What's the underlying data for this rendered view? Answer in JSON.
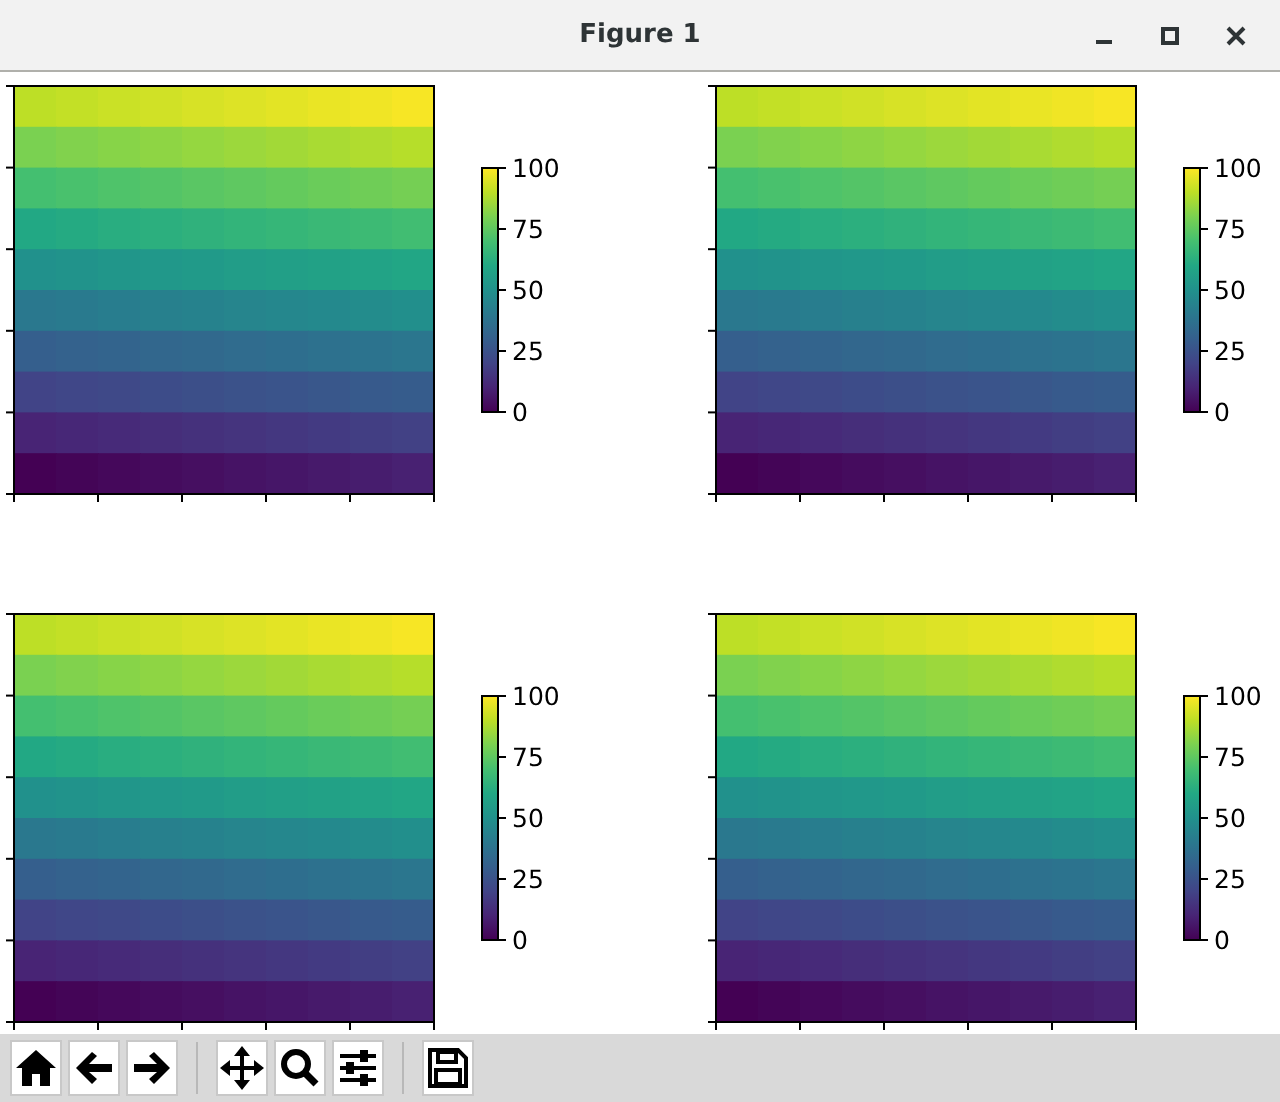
{
  "window": {
    "title": "Figure 1",
    "controls": [
      {
        "kind": "minimize"
      },
      {
        "kind": "maximize"
      },
      {
        "kind": "close"
      }
    ]
  },
  "subplots": [
    {
      "colorbar": {
        "ticks": [
          "100",
          "75",
          "50",
          "25",
          "0"
        ]
      }
    },
    {
      "colorbar": {
        "ticks": [
          "100",
          "75",
          "50",
          "25",
          "0"
        ]
      }
    },
    {
      "colorbar": {
        "ticks": [
          "100",
          "75",
          "50",
          "25",
          "0"
        ]
      }
    },
    {
      "colorbar": {
        "ticks": [
          "100",
          "75",
          "50",
          "25",
          "0"
        ]
      }
    }
  ],
  "toolbar": [
    {
      "kind": "home"
    },
    {
      "kind": "back"
    },
    {
      "kind": "forward"
    },
    {
      "kind": "separator"
    },
    {
      "kind": "pan"
    },
    {
      "kind": "zoom"
    },
    {
      "kind": "configure"
    },
    {
      "kind": "separator"
    },
    {
      "kind": "save"
    }
  ]
}
